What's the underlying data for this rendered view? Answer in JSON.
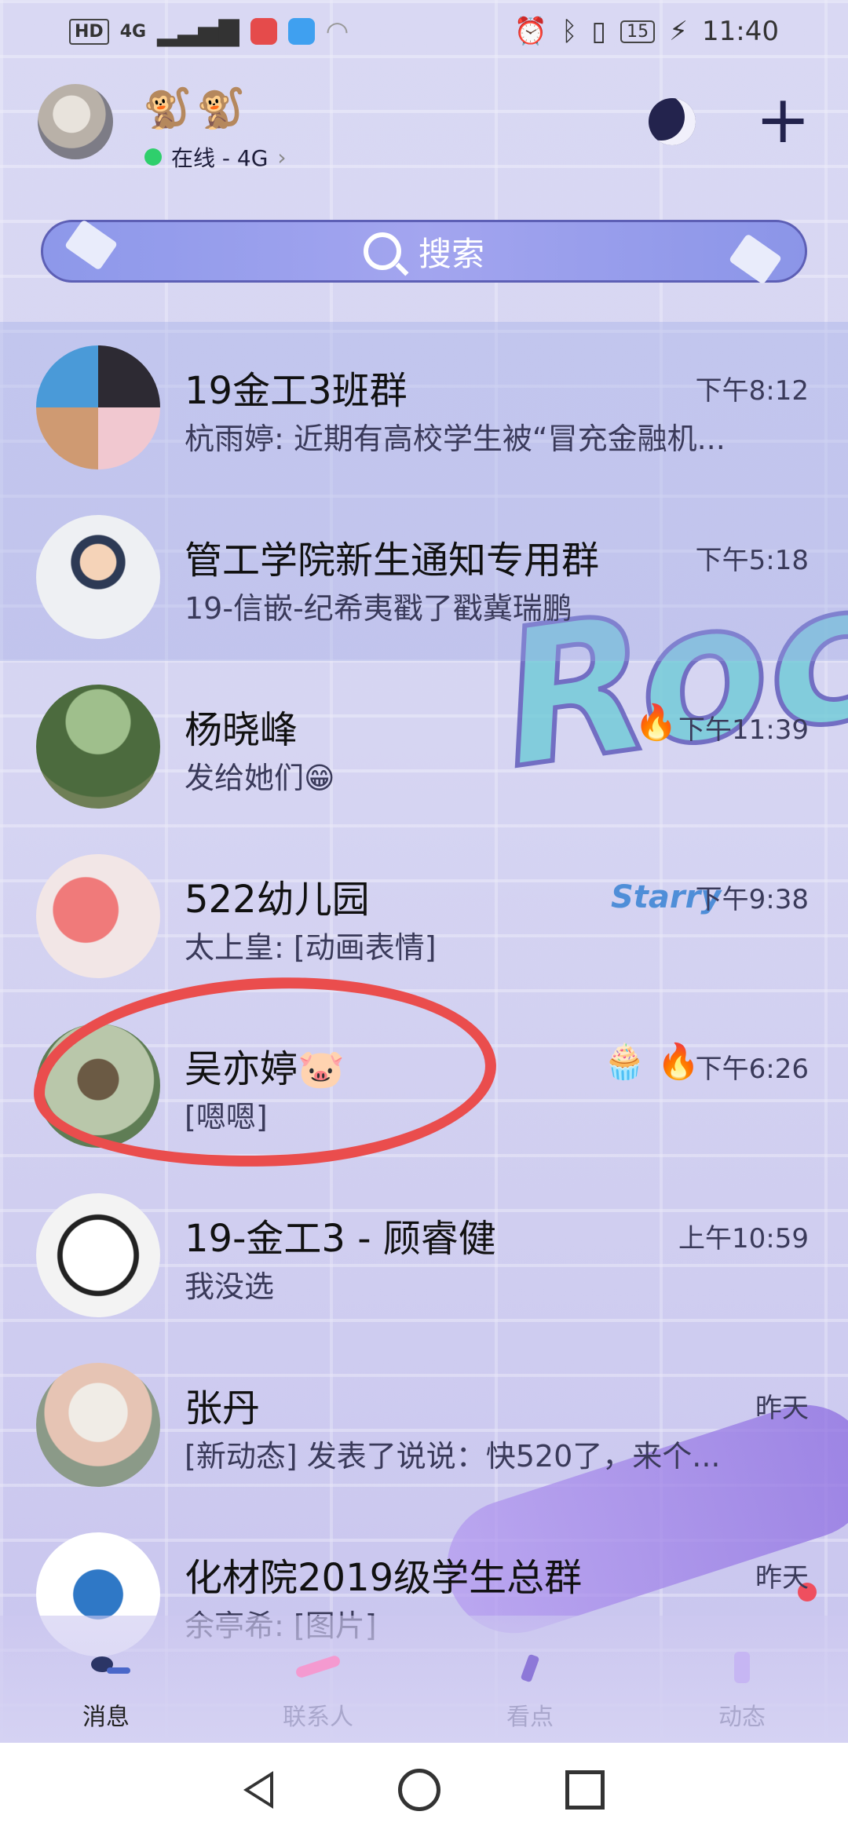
{
  "status_bar": {
    "left_icons": [
      "HD",
      "4G",
      "signal-icon",
      "app-red-icon",
      "app-blue-icon",
      "wifi-icon"
    ],
    "hd_label": "HD",
    "net_label": "4G",
    "battery": "15",
    "time": "11:40"
  },
  "header": {
    "nickname": "🐒🐒",
    "status": "在线 - 4G",
    "status_chevron": "›"
  },
  "search": {
    "placeholder": "搜索"
  },
  "chats": [
    {
      "name": "19金工3班群",
      "preview": "杭雨婷: 近期有高校学生被“冒充金融机...",
      "time": "下午8:12",
      "badges": ""
    },
    {
      "name": "管工学院新生通知专用群",
      "preview": "19-信嵌-纪希夷戳了戳冀瑞鹏",
      "time": "下午5:18",
      "badges": ""
    },
    {
      "name": "杨晓峰",
      "preview": "发给她们😁",
      "time": "下午11:39",
      "badges": "🔥"
    },
    {
      "name": "522幼儿园",
      "preview": "太上皇: [动画表情]",
      "time": "下午9:38",
      "badges": "Starry"
    },
    {
      "name": "吴亦婷🐷",
      "preview": "[嗯嗯]",
      "time": "下午6:26",
      "badges": "🧁 🔥"
    },
    {
      "name": "19-金工3 - 顾睿健",
      "preview": "我没选",
      "time": "上午10:59",
      "badges": ""
    },
    {
      "name": "张丹",
      "preview": "[新动态] 发表了说说：快520了，来个...",
      "time": "昨天",
      "badges": ""
    },
    {
      "name": "化材院2019级学生总群",
      "preview": "余亭希: [图片]",
      "time": "昨天",
      "badges": ""
    }
  ],
  "graffiti_text": "Roc",
  "tabs": [
    {
      "label": "消息",
      "active": true
    },
    {
      "label": "联系人",
      "active": false
    },
    {
      "label": "看点",
      "active": false
    },
    {
      "label": "动态",
      "active": false
    }
  ],
  "colors": {
    "accent": "#5d5fb5",
    "online": "#2fcf6c",
    "annotation": "#ea4d4d"
  }
}
